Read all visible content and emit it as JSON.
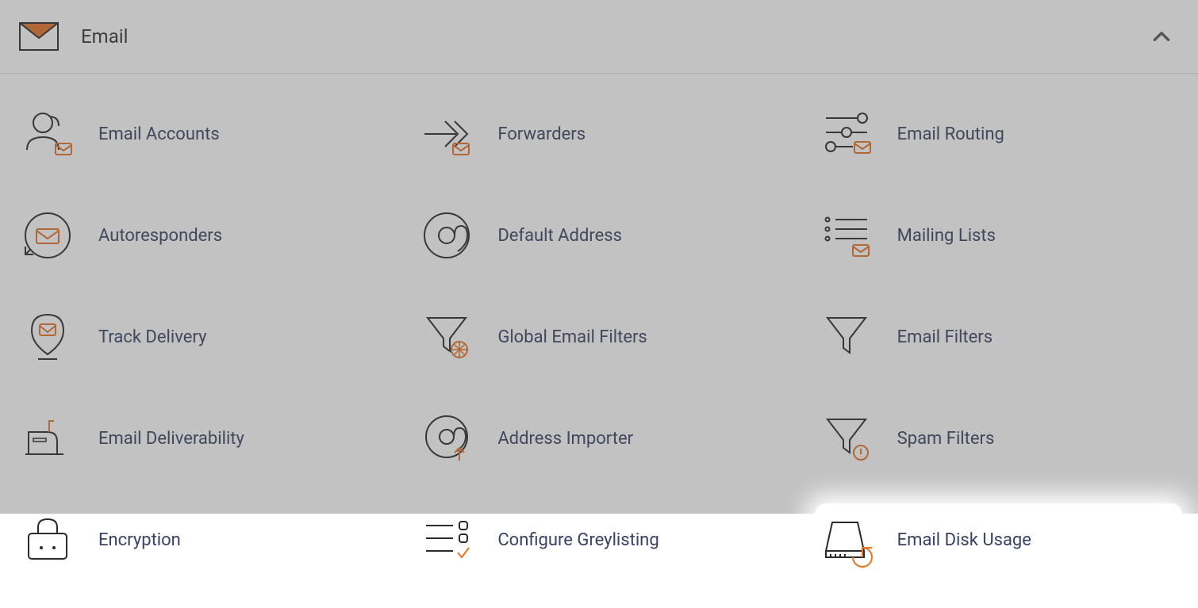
{
  "panel": {
    "title": "Email",
    "items": [
      {
        "id": "email-accounts",
        "label": "Email Accounts",
        "icon": "email-accounts-icon"
      },
      {
        "id": "forwarders",
        "label": "Forwarders",
        "icon": "forwarders-icon"
      },
      {
        "id": "email-routing",
        "label": "Email Routing",
        "icon": "email-routing-icon"
      },
      {
        "id": "autoresponders",
        "label": "Autoresponders",
        "icon": "autoresponders-icon"
      },
      {
        "id": "default-address",
        "label": "Default Address",
        "icon": "default-address-icon"
      },
      {
        "id": "mailing-lists",
        "label": "Mailing Lists",
        "icon": "mailing-lists-icon"
      },
      {
        "id": "track-delivery",
        "label": "Track Delivery",
        "icon": "track-delivery-icon"
      },
      {
        "id": "global-email-filters",
        "label": "Global Email Filters",
        "icon": "global-email-filters-icon"
      },
      {
        "id": "email-filters",
        "label": "Email Filters",
        "icon": "email-filters-icon"
      },
      {
        "id": "email-deliverability",
        "label": "Email Deliverability",
        "icon": "email-deliverability-icon"
      },
      {
        "id": "address-importer",
        "label": "Address Importer",
        "icon": "address-importer-icon"
      },
      {
        "id": "spam-filters",
        "label": "Spam Filters",
        "icon": "spam-filters-icon"
      },
      {
        "id": "encryption",
        "label": "Encryption",
        "icon": "encryption-icon"
      },
      {
        "id": "configure-greylisting",
        "label": "Configure Greylisting",
        "icon": "configure-greylisting-icon"
      },
      {
        "id": "email-disk-usage",
        "label": "Email Disk Usage",
        "icon": "email-disk-usage-icon",
        "highlighted": true
      }
    ]
  },
  "colors": {
    "accent": "#e77528",
    "text": "#394263",
    "stroke": "#2b2b2b"
  }
}
